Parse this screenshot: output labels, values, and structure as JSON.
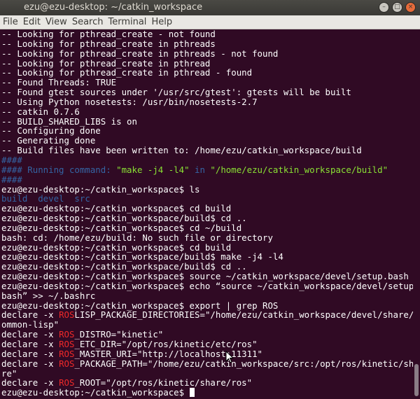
{
  "window": {
    "title": "ezu@ezu-desktop: ~/catkin_workspace",
    "buttons": {
      "close": "×",
      "minimize": "–",
      "maximize": "□"
    }
  },
  "menubar": {
    "items": [
      "File",
      "Edit",
      "View",
      "Search",
      "Terminal",
      "Help"
    ]
  },
  "terminal": {
    "prompt": "ezu@ezu-desktop:~/catkin_workspace$ ",
    "lines": [
      [
        {
          "t": "-- Looking for pthread_create - not found",
          "c": "plain"
        }
      ],
      [
        {
          "t": "-- Looking for pthread_create in pthreads",
          "c": "plain"
        }
      ],
      [
        {
          "t": "-- Looking for pthread_create in pthreads - not found",
          "c": "plain"
        }
      ],
      [
        {
          "t": "-- Looking for pthread_create in pthread",
          "c": "plain"
        }
      ],
      [
        {
          "t": "-- Looking for pthread_create in pthread - found",
          "c": "plain"
        }
      ],
      [
        {
          "t": "-- Found Threads: TRUE",
          "c": "plain"
        }
      ],
      [
        {
          "t": "-- Found gtest sources under '/usr/src/gtest': gtests will be built",
          "c": "plain"
        }
      ],
      [
        {
          "t": "-- Using Python nosetests: /usr/bin/nosetests-2.7",
          "c": "plain"
        }
      ],
      [
        {
          "t": "-- catkin 0.7.6",
          "c": "plain"
        }
      ],
      [
        {
          "t": "-- BUILD_SHARED_LIBS is on",
          "c": "plain"
        }
      ],
      [
        {
          "t": "-- Configuring done",
          "c": "plain"
        }
      ],
      [
        {
          "t": "-- Generating done",
          "c": "plain"
        }
      ],
      [
        {
          "t": "-- Build files have been written to: /home/ezu/catkin_workspace/build",
          "c": "plain"
        }
      ],
      [
        {
          "t": "####",
          "c": "blue"
        }
      ],
      [
        {
          "t": "#### Running command: ",
          "c": "blue"
        },
        {
          "t": "\"make -j4 -l4\"",
          "c": "green"
        },
        {
          "t": " in ",
          "c": "blue"
        },
        {
          "t": "\"/home/ezu/catkin_workspace/build\"",
          "c": "green"
        }
      ],
      [
        {
          "t": "####",
          "c": "blue"
        }
      ],
      [
        {
          "t": "ezu@ezu-desktop:~/catkin_workspace$ ls",
          "c": "plain"
        }
      ],
      [
        {
          "t": "build  devel  src",
          "c": "blue"
        }
      ],
      [
        {
          "t": "ezu@ezu-desktop:~/catkin_workspace$ cd build",
          "c": "plain"
        }
      ],
      [
        {
          "t": "ezu@ezu-desktop:~/catkin_workspace/build$ cd ..",
          "c": "plain"
        }
      ],
      [
        {
          "t": "ezu@ezu-desktop:~/catkin_workspace$ cd ~/build",
          "c": "plain"
        }
      ],
      [
        {
          "t": "bash: cd: /home/ezu/build: No such file or directory",
          "c": "plain"
        }
      ],
      [
        {
          "t": "ezu@ezu-desktop:~/catkin_workspace$ cd build",
          "c": "plain"
        }
      ],
      [
        {
          "t": "ezu@ezu-desktop:~/catkin_workspace/build$ make -j4 -l4",
          "c": "plain"
        }
      ],
      [
        {
          "t": "ezu@ezu-desktop:~/catkin_workspace/build$ cd ..",
          "c": "plain"
        }
      ],
      [
        {
          "t": "ezu@ezu-desktop:~/catkin_workspace$ source ~/catkin_workspace/devel/setup.bash",
          "c": "plain"
        }
      ],
      [
        {
          "t": "ezu@ezu-desktop:~/catkin_workspace$ echo “source ~/catkin_workspace/devel/setup.",
          "c": "plain"
        }
      ],
      [
        {
          "t": "bash” >> ~/.bashrc",
          "c": "plain"
        }
      ],
      [
        {
          "t": "ezu@ezu-desktop:~/catkin_workspace$ export | grep ROS",
          "c": "plain"
        }
      ],
      [
        {
          "t": "declare -x ",
          "c": "plain"
        },
        {
          "t": "ROS",
          "c": "red"
        },
        {
          "t": "LISP_PACKAGE_DIRECTORIES=\"/home/ezu/catkin_workspace/devel/share/c",
          "c": "plain"
        }
      ],
      [
        {
          "t": "ommon-lisp\"",
          "c": "plain"
        }
      ],
      [
        {
          "t": "declare -x ",
          "c": "plain"
        },
        {
          "t": "ROS",
          "c": "red"
        },
        {
          "t": "_DISTRO=\"kinetic\"",
          "c": "plain"
        }
      ],
      [
        {
          "t": "declare -x ",
          "c": "plain"
        },
        {
          "t": "ROS",
          "c": "red"
        },
        {
          "t": "_ETC_DIR=\"/opt/ros/kinetic/etc/ros\"",
          "c": "plain"
        }
      ],
      [
        {
          "t": "declare -x ",
          "c": "plain"
        },
        {
          "t": "ROS",
          "c": "red"
        },
        {
          "t": "_MASTER_URI=\"http://localhost:11311\"",
          "c": "plain"
        }
      ],
      [
        {
          "t": "declare -x ",
          "c": "plain"
        },
        {
          "t": "ROS",
          "c": "red"
        },
        {
          "t": "_PACKAGE_PATH=\"/home/ezu/catkin_workspace/src:/opt/ros/kinetic/sha",
          "c": "plain"
        }
      ],
      [
        {
          "t": "re\"",
          "c": "plain"
        }
      ],
      [
        {
          "t": "declare -x ",
          "c": "plain"
        },
        {
          "t": "ROS",
          "c": "red"
        },
        {
          "t": "_ROOT=\"/opt/ros/kinetic/share/ros\"",
          "c": "plain"
        }
      ]
    ]
  },
  "colors": {
    "terminal_bg": "#300a24",
    "blue": "#3465a4",
    "green": "#8ae234",
    "red": "#ef2929",
    "text": "#ffffff"
  }
}
